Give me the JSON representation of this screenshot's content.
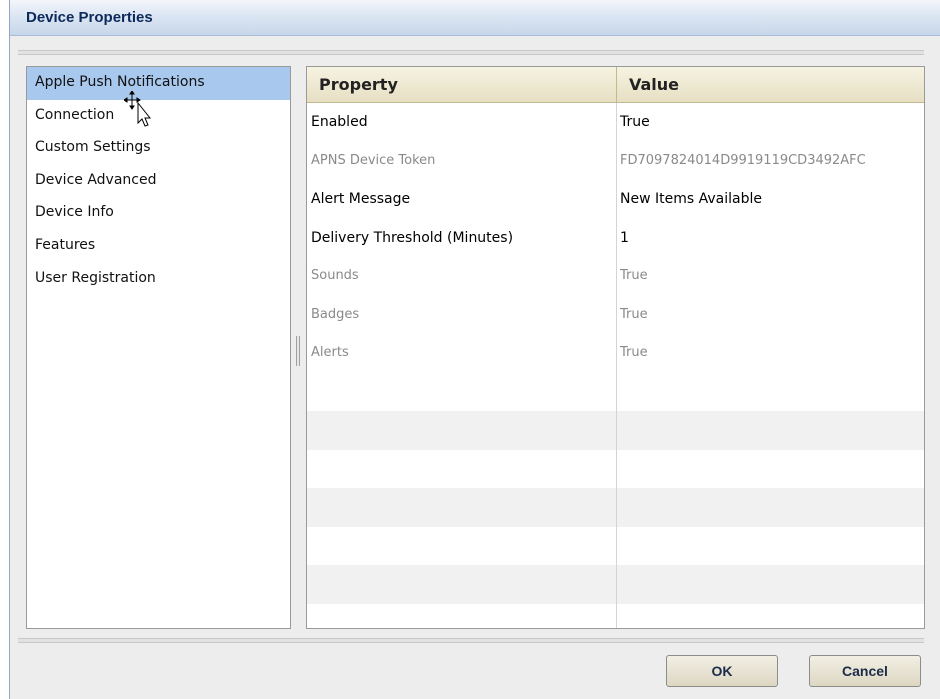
{
  "window": {
    "title": "Device Properties"
  },
  "sidebar": {
    "items": [
      {
        "label": "Apple Push Notifications",
        "selected": true
      },
      {
        "label": "Connection",
        "selected": false
      },
      {
        "label": "Custom Settings",
        "selected": false
      },
      {
        "label": "Device Advanced",
        "selected": false
      },
      {
        "label": "Device Info",
        "selected": false
      },
      {
        "label": "Features",
        "selected": false
      },
      {
        "label": "User Registration",
        "selected": false
      }
    ]
  },
  "grid": {
    "headers": {
      "property": "Property",
      "value": "Value"
    },
    "rows": [
      {
        "property": "Enabled",
        "value": "True",
        "disabled": false
      },
      {
        "property": "APNS Device Token",
        "value": "FD7097824014D9919119CD3492AFC",
        "disabled": true
      },
      {
        "property": "Alert Message",
        "value": "New Items Available",
        "disabled": false
      },
      {
        "property": "Delivery Threshold (Minutes)",
        "value": "1",
        "disabled": false
      },
      {
        "property": "Sounds",
        "value": "True",
        "disabled": true
      },
      {
        "property": "Badges",
        "value": "True",
        "disabled": true
      },
      {
        "property": "Alerts",
        "value": "True",
        "disabled": true
      }
    ],
    "empty_rows": 7
  },
  "buttons": {
    "ok": "OK",
    "cancel": "Cancel"
  },
  "colors": {
    "selection": "#a9c8ee",
    "title_text": "#0b2a5b",
    "header_bg": "#e6dfc3",
    "disabled_text": "#8a8a8a"
  },
  "icons": {
    "cursor": "move-cursor-icon"
  }
}
